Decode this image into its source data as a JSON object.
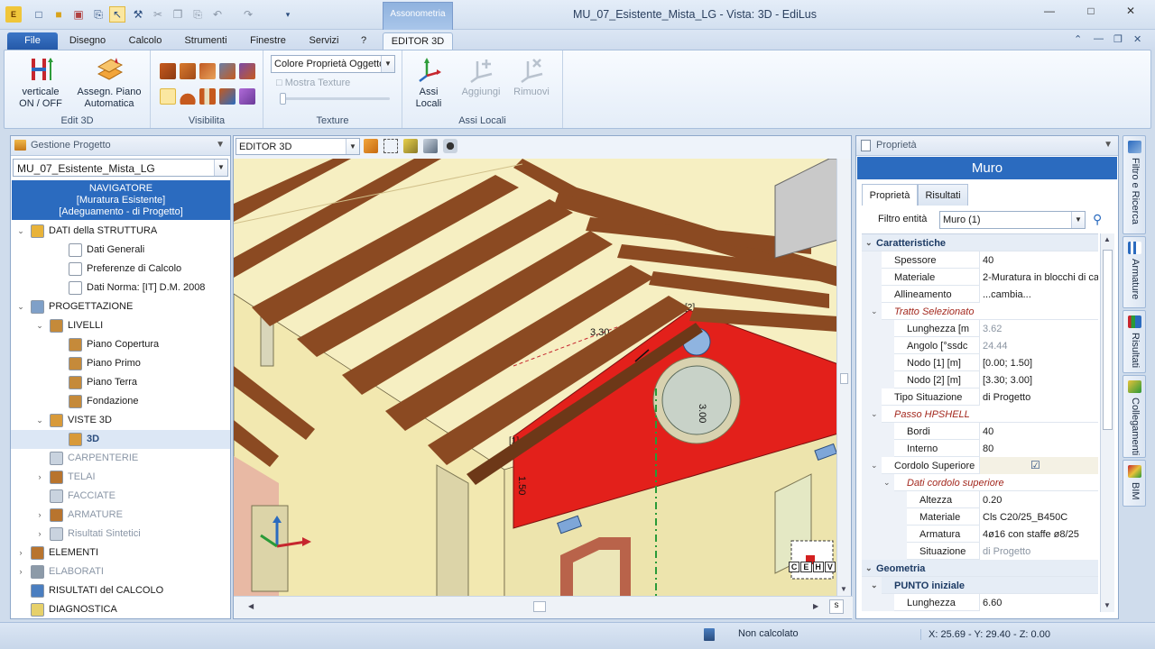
{
  "title_bar": {
    "app_title": "MU_07_Esistente_Mista_LG -  Vista: 3D - EdiLus",
    "contextual_tab_group": "Assonometria"
  },
  "ribbon_tabs": [
    "File",
    "Disegno",
    "Calcolo",
    "Strumenti",
    "Finestre",
    "Servizi",
    "?",
    "EDITOR 3D"
  ],
  "ribbon": {
    "edit3d": {
      "label": "Edit 3D",
      "btn_vertical_l1": "verticale",
      "btn_vertical_l2": "ON / OFF",
      "btn_assegn_l1": "Assegn. Piano",
      "btn_assegn_l2": "Automatica"
    },
    "visibilita": {
      "label": "Visibilita"
    },
    "texture": {
      "label": "Texture",
      "combo_value": "Colore Proprietà Oggetto",
      "mostra_texture": "Mostra Texture"
    },
    "assi_locali": {
      "label": "Assi Locali",
      "btn_assi_l1": "Assi",
      "btn_assi_l2": "Locali",
      "btn_aggiungi": "Aggiungi",
      "btn_rimuovi": "Rimuovi"
    }
  },
  "navigator": {
    "header": "Gestione Progetto",
    "project": "MU_07_Esistente_Mista_LG",
    "box_l1": "NAVIGATORE",
    "box_l2": "[Muratura Esistente]",
    "box_l3": "[Adeguamento - di Progetto]",
    "tree": [
      {
        "label": "DATI della STRUTTURA",
        "level": 0,
        "exp": "v",
        "icon": "#e8b33a"
      },
      {
        "label": "Dati Generali",
        "level": 2,
        "exp": "",
        "icon": "#ffffff"
      },
      {
        "label": "Preferenze di Calcolo",
        "level": 2,
        "exp": "",
        "icon": "#ffffff"
      },
      {
        "label": "Dati Norma: [IT] D.M. 2008",
        "level": 2,
        "exp": "",
        "icon": "#ffffff"
      },
      {
        "label": "PROGETTAZIONE",
        "level": 0,
        "exp": "v",
        "icon": "#7fa0c8"
      },
      {
        "label": "LIVELLI",
        "level": 1,
        "exp": "v",
        "icon": "#c58a3a"
      },
      {
        "label": "Piano Copertura",
        "level": 2,
        "exp": "",
        "icon": "#c58a3a"
      },
      {
        "label": "Piano Primo",
        "level": 2,
        "exp": "",
        "icon": "#c58a3a"
      },
      {
        "label": "Piano Terra",
        "level": 2,
        "exp": "",
        "icon": "#c58a3a"
      },
      {
        "label": "Fondazione",
        "level": 2,
        "exp": "",
        "icon": "#c58a3a"
      },
      {
        "label": "VISTE 3D",
        "level": 1,
        "exp": "v",
        "icon": "#d89a3a"
      },
      {
        "label": "3D",
        "level": 2,
        "exp": "",
        "icon": "#d89a3a",
        "sel": true
      },
      {
        "label": "CARPENTERIE",
        "level": 1,
        "exp": "",
        "icon": "#c9d3df",
        "dim": true
      },
      {
        "label": "TELAI",
        "level": 1,
        "exp": ">",
        "icon": "#b8742e",
        "dim": true
      },
      {
        "label": "FACCIATE",
        "level": 1,
        "exp": "",
        "icon": "#c9d3df",
        "dim": true
      },
      {
        "label": "ARMATURE",
        "level": 1,
        "exp": ">",
        "icon": "#b8742e",
        "dim": true
      },
      {
        "label": "Risultati Sintetici",
        "level": 1,
        "exp": ">",
        "icon": "#c9d3df",
        "dim": true
      },
      {
        "label": "ELEMENTI",
        "level": 0,
        "exp": ">",
        "icon": "#b8742e"
      },
      {
        "label": "ELABORATI",
        "level": 0,
        "exp": ">",
        "icon": "#8c9aa8",
        "dim": true
      },
      {
        "label": "RISULTATI del CALCOLO",
        "level": 0,
        "exp": "",
        "icon": "#4a7ec0"
      },
      {
        "label": "DIAGNOSTICA",
        "level": 0,
        "exp": "",
        "icon": "#e6d06a"
      }
    ]
  },
  "viewport": {
    "combo": "EDITOR 3D",
    "dim_length": "3,30",
    "dim_height": "3.00",
    "dim_side": "1.50",
    "node1": "[1]",
    "node2": "[2]",
    "cube": [
      "C",
      "E",
      "H",
      "V"
    ],
    "scroll_s": "s"
  },
  "properties": {
    "header": "Proprietà",
    "title": "Muro",
    "tabs": [
      "Proprietà",
      "Risultati"
    ],
    "filter_label": "Filtro entità",
    "filter_value": "Muro (1)",
    "rows": [
      {
        "type": "cat",
        "k": "Caratteristiche",
        "tw": "v",
        "ind": 0
      },
      {
        "k": "Spessore",
        "v": "40",
        "ind": 1
      },
      {
        "k": "Materiale",
        "v": "2-Muratura in blocchi di ca",
        "ind": 1
      },
      {
        "k": "Allineamento",
        "v": "...cambia...",
        "ind": 1
      },
      {
        "type": "sub",
        "k": "Tratto Selezionato",
        "tw": "v",
        "ind": 1
      },
      {
        "k": "Lunghezza  [m",
        "v": "3.62",
        "ind": 2,
        "grey": true
      },
      {
        "k": "Angolo  [°ssdc",
        "v": "24.44",
        "ind": 2,
        "grey": true
      },
      {
        "k": "Nodo [1]  [m]",
        "v": "[0.00; 1.50]",
        "ind": 2
      },
      {
        "k": "Nodo [2]  [m]",
        "v": "[3.30; 3.00]",
        "ind": 2
      },
      {
        "k": "Tipo Situazione",
        "v": "di Progetto",
        "ind": 1
      },
      {
        "type": "sub",
        "k": "Passo HPSHELL",
        "tw": "v",
        "ind": 1
      },
      {
        "k": "Bordi",
        "v": "40",
        "ind": 2
      },
      {
        "k": "Interno",
        "v": "80",
        "ind": 2
      },
      {
        "k": "Cordolo Superiore",
        "v": "",
        "check": true,
        "tw": "v",
        "ind": 1
      },
      {
        "type": "sub",
        "k": "Dati cordolo superiore",
        "tw": "v",
        "ind": 2
      },
      {
        "k": "Altezza",
        "v": "0.20",
        "ind": 3
      },
      {
        "k": "Materiale",
        "v": "Cls C20/25_B450C",
        "ind": 3
      },
      {
        "k": "Armatura",
        "v": "4ø16 con staffe ø8/25",
        "ind": 3
      },
      {
        "k": "Situazione",
        "v": "di Progetto",
        "ind": 3,
        "grey": true
      },
      {
        "type": "cat",
        "k": "Geometria",
        "tw": "v",
        "ind": 0
      },
      {
        "type": "cat2",
        "k": "PUNTO iniziale",
        "tw": "v",
        "ind": 1
      },
      {
        "k": "Lunghezza",
        "v": "6.60",
        "ind": 2
      }
    ]
  },
  "side_tabs": [
    "Filtro e Ricerca",
    "Armature",
    "Risultati",
    "Collegamenti",
    "BIM"
  ],
  "status": {
    "calc": "Non calcolato",
    "coords": "X: 25.69 - Y: 29.40 - Z: 0.00"
  },
  "colors": {
    "accent": "#2b6bbf",
    "wall_red": "#e3201b",
    "beam_brown": "#8b4a22",
    "wall_cream": "#f6efc2"
  }
}
